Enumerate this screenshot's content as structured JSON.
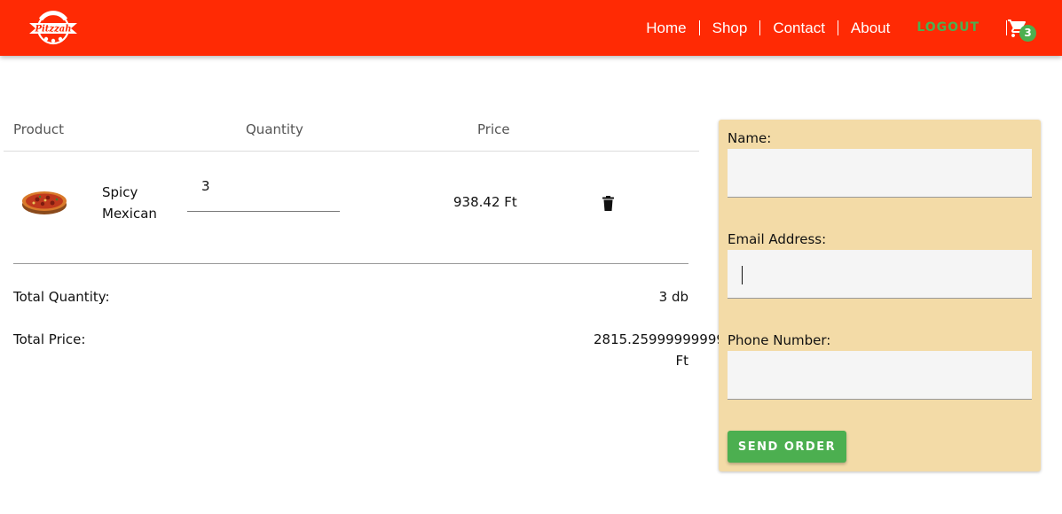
{
  "navbar": {
    "brand": "Pitzzah",
    "links": [
      "Home",
      "Shop",
      "Contact",
      "About"
    ],
    "logout_label": "LOGOUT",
    "cart_count": "3",
    "colors": {
      "bar": "#ff2a04",
      "accent": "#4caf50"
    }
  },
  "cart": {
    "headers": {
      "product": "Product",
      "quantity": "Quantity",
      "price": "Price"
    },
    "items": [
      {
        "name": "Spicy Mexican",
        "quantity": "3",
        "price": "938.42 Ft"
      }
    ],
    "total_quantity_label": "Total Quantity:",
    "total_quantity_value": "3 db",
    "total_price_label": "Total Price:",
    "total_price_value": "2815.25999999999",
    "total_price_unit": "Ft"
  },
  "order_form": {
    "name_label": "Name:",
    "email_label": "Email Address:",
    "phone_label": "Phone Number:",
    "name_value": "",
    "email_value": "",
    "phone_value": "",
    "send_label": "SEND ORDER",
    "colors": {
      "panel": "#f3dba7",
      "button": "#4caf50"
    }
  }
}
